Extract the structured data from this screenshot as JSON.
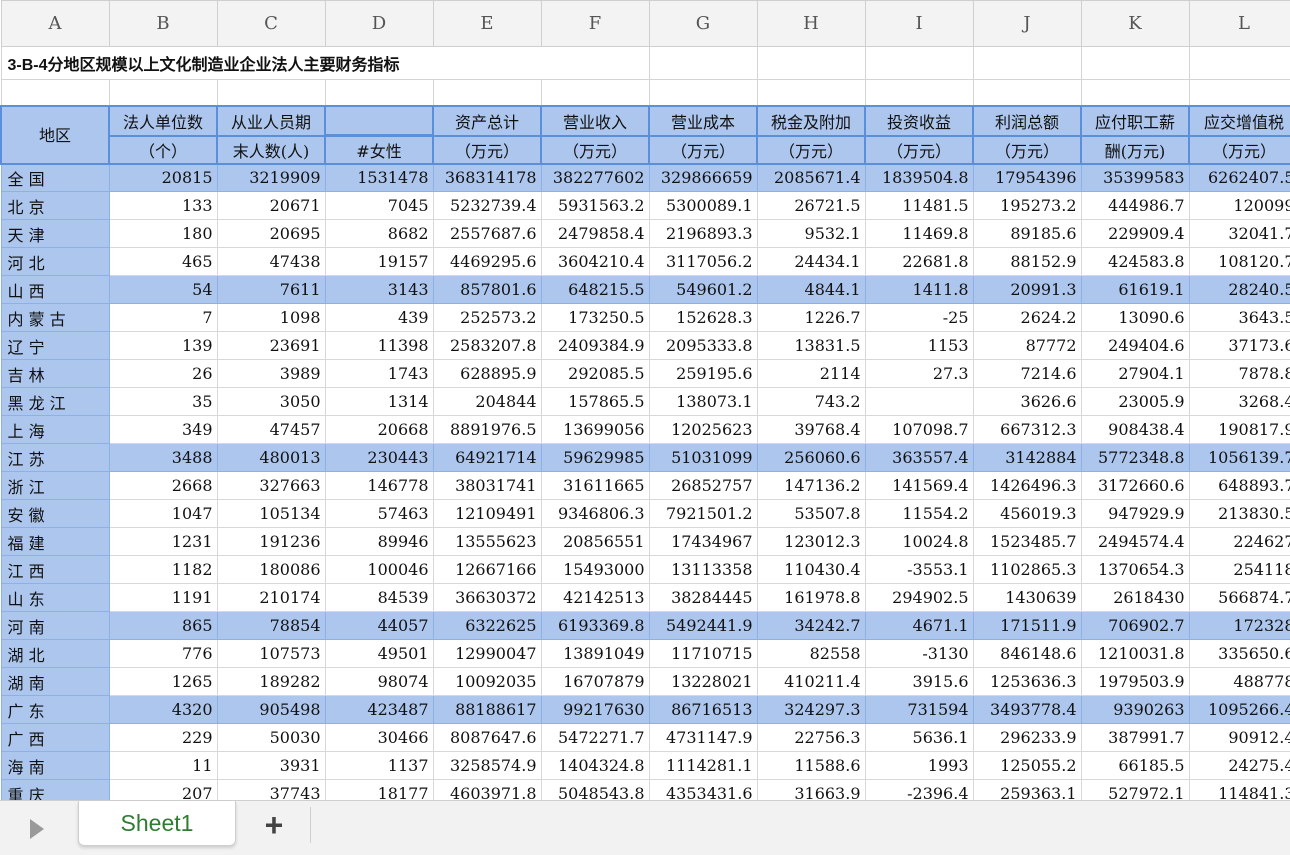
{
  "columns": [
    "A",
    "B",
    "C",
    "D",
    "E",
    "F",
    "G",
    "H",
    "I",
    "J",
    "K",
    "L"
  ],
  "title": "3-B-4分地区规模以上文化制造业企业法人主要财务指标",
  "headers": {
    "region": "地区",
    "col_b_1": "法人单位数",
    "col_b_2": "（个）",
    "col_c_1": "从业人员期",
    "col_c_2": "末人数(人)",
    "col_d_2": "#女性",
    "col_e_1": "资产总计",
    "col_e_2": "（万元）",
    "col_f_1": "营业收入",
    "col_f_2": "（万元）",
    "col_g_1": "营业成本",
    "col_g_2": "（万元）",
    "col_h_1": "税金及附加",
    "col_h_2": "（万元）",
    "col_i_1": "投资收益",
    "col_i_2": "（万元）",
    "col_j_1": "利润总额",
    "col_j_2": "（万元）",
    "col_k_1": "应付职工薪",
    "col_k_2": "酬(万元)",
    "col_l_1": "应交增值税",
    "col_l_2": "（万元）"
  },
  "rows": [
    {
      "region": "全 国",
      "values": [
        "20815",
        "3219909",
        "1531478",
        "368314178",
        "382277602",
        "329866659",
        "2085671.4",
        "1839504.8",
        "17954396",
        "35399583",
        "6262407.5"
      ]
    },
    {
      "region": "北 京",
      "values": [
        "133",
        "20671",
        "7045",
        "5232739.4",
        "5931563.2",
        "5300089.1",
        "26721.5",
        "11481.5",
        "195273.2",
        "444986.7",
        "120099"
      ]
    },
    {
      "region": "天 津",
      "values": [
        "180",
        "20695",
        "8682",
        "2557687.6",
        "2479858.4",
        "2196893.3",
        "9532.1",
        "11469.8",
        "89185.6",
        "229909.4",
        "32041.7"
      ]
    },
    {
      "region": "河 北",
      "values": [
        "465",
        "47438",
        "19157",
        "4469295.6",
        "3604210.4",
        "3117056.2",
        "24434.1",
        "22681.8",
        "88152.9",
        "424583.8",
        "108120.7"
      ]
    },
    {
      "region": "山 西",
      "values": [
        "54",
        "7611",
        "3143",
        "857801.6",
        "648215.5",
        "549601.2",
        "4844.1",
        "1411.8",
        "20991.3",
        "61619.1",
        "28240.5"
      ]
    },
    {
      "region": "内 蒙 古",
      "values": [
        "7",
        "1098",
        "439",
        "252573.2",
        "173250.5",
        "152628.3",
        "1226.7",
        "-25",
        "2624.2",
        "13090.6",
        "3643.5"
      ]
    },
    {
      "region": "辽 宁",
      "values": [
        "139",
        "23691",
        "11398",
        "2583207.8",
        "2409384.9",
        "2095333.8",
        "13831.5",
        "1153",
        "87772",
        "249404.6",
        "37173.6"
      ]
    },
    {
      "region": "吉 林",
      "values": [
        "26",
        "3989",
        "1743",
        "628895.9",
        "292085.5",
        "259195.6",
        "2114",
        "27.3",
        "7214.6",
        "27904.1",
        "7878.8"
      ]
    },
    {
      "region": "黑 龙 江",
      "values": [
        "35",
        "3050",
        "1314",
        "204844",
        "157865.5",
        "138073.1",
        "743.2",
        "",
        "3626.6",
        "23005.9",
        "3268.4"
      ]
    },
    {
      "region": "上 海",
      "values": [
        "349",
        "47457",
        "20668",
        "8891976.5",
        "13699056",
        "12025623",
        "39768.4",
        "107098.7",
        "667312.3",
        "908438.4",
        "190817.9"
      ]
    },
    {
      "region": "江 苏",
      "values": [
        "3488",
        "480013",
        "230443",
        "64921714",
        "59629985",
        "51031099",
        "256060.6",
        "363557.4",
        "3142884",
        "5772348.8",
        "1056139.7"
      ]
    },
    {
      "region": "浙 江",
      "values": [
        "2668",
        "327663",
        "146778",
        "38031741",
        "31611665",
        "26852757",
        "147136.2",
        "141569.4",
        "1426496.3",
        "3172660.6",
        "648893.7"
      ]
    },
    {
      "region": "安 徽",
      "values": [
        "1047",
        "105134",
        "57463",
        "12109491",
        "9346806.3",
        "7921501.2",
        "53507.8",
        "11554.2",
        "456019.3",
        "947929.9",
        "213830.5"
      ]
    },
    {
      "region": "福 建",
      "values": [
        "1231",
        "191236",
        "89946",
        "13555623",
        "20856551",
        "17434967",
        "123012.3",
        "10024.8",
        "1523485.7",
        "2494574.4",
        "224627"
      ]
    },
    {
      "region": "江 西",
      "values": [
        "1182",
        "180086",
        "100046",
        "12667166",
        "15493000",
        "13113358",
        "110430.4",
        "-3553.1",
        "1102865.3",
        "1370654.3",
        "254118"
      ]
    },
    {
      "region": "山 东",
      "values": [
        "1191",
        "210174",
        "84539",
        "36630372",
        "42142513",
        "38284445",
        "161978.8",
        "294902.5",
        "1430639",
        "2618430",
        "566874.7"
      ]
    },
    {
      "region": "河 南",
      "values": [
        "865",
        "78854",
        "44057",
        "6322625",
        "6193369.8",
        "5492441.9",
        "34242.7",
        "4671.1",
        "171511.9",
        "706902.7",
        "172328"
      ]
    },
    {
      "region": "湖 北",
      "values": [
        "776",
        "107573",
        "49501",
        "12990047",
        "13891049",
        "11710715",
        "82558",
        "-3130",
        "846148.6",
        "1210031.8",
        "335650.6"
      ]
    },
    {
      "region": "湖 南",
      "values": [
        "1265",
        "189282",
        "98074",
        "10092035",
        "16707879",
        "13228021",
        "410211.4",
        "3915.6",
        "1253636.3",
        "1979503.9",
        "488778"
      ]
    },
    {
      "region": "广 东",
      "values": [
        "4320",
        "905498",
        "423487",
        "88188617",
        "99217630",
        "86716513",
        "324297.3",
        "731594",
        "3493778.4",
        "9390263",
        "1095266.4"
      ]
    },
    {
      "region": "广 西",
      "values": [
        "229",
        "50030",
        "30466",
        "8087647.6",
        "5472271.7",
        "4731147.9",
        "22756.3",
        "5636.1",
        "296233.9",
        "387991.7",
        "90912.4"
      ]
    },
    {
      "region": "海 南",
      "values": [
        "11",
        "3931",
        "1137",
        "3258574.9",
        "1404324.8",
        "1114281.1",
        "11588.6",
        "1993",
        "125055.2",
        "66185.5",
        "24275.4"
      ]
    },
    {
      "region": "重 庆",
      "values": [
        "207",
        "37743",
        "18177",
        "4603971.8",
        "5048543.8",
        "4353431.6",
        "31663.9",
        "-2396.4",
        "259363.1",
        "527972.1",
        "114841.3"
      ]
    }
  ],
  "tabs": {
    "sheet1": "Sheet1",
    "add": "+"
  }
}
